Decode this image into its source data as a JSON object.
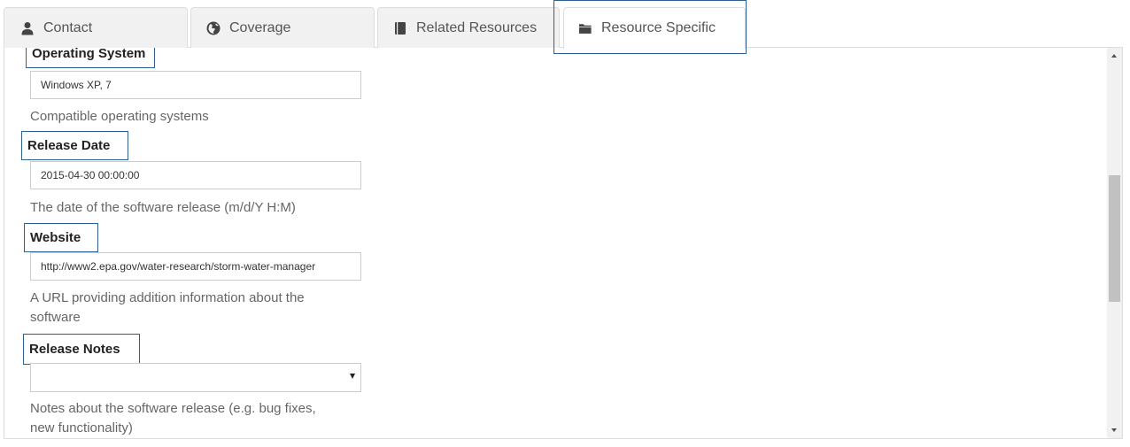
{
  "tabs": [
    {
      "label": "Contact",
      "icon": "user-icon",
      "active": false
    },
    {
      "label": "Coverage",
      "icon": "globe-icon",
      "active": false
    },
    {
      "label": "Related Resources",
      "icon": "book-icon",
      "active": false
    },
    {
      "label": "Resource Specific",
      "icon": "folder-icon",
      "active": true
    }
  ],
  "fields": {
    "operating_system": {
      "label": "Operating System",
      "value": "Windows XP, 7",
      "help": "Compatible operating systems"
    },
    "release_date": {
      "label": "Release Date",
      "value": "2015-04-30 00:00:00",
      "help": "The date of the software release (m/d/Y H:M)"
    },
    "website": {
      "label": "Website",
      "value": "http://www2.epa.gov/water-research/storm-water-manager",
      "help": "A URL providing addition information about the software"
    },
    "release_notes": {
      "label": "Release Notes",
      "value": "",
      "help": "Notes about the software release (e.g. bug fixes, new functionality)"
    }
  },
  "colors": {
    "highlight_border": "#2f5f8f",
    "tab_inactive_bg": "#f1f1f1",
    "help_text": "#666666"
  }
}
